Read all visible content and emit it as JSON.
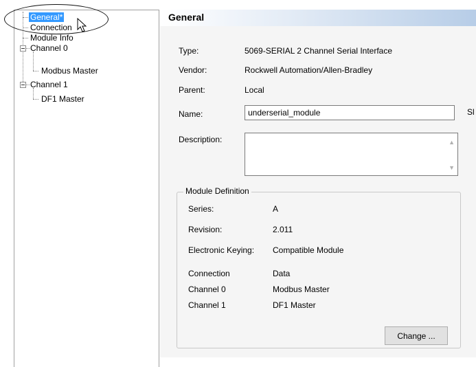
{
  "tree": {
    "items": [
      {
        "label": "General*",
        "selected": true
      },
      {
        "label": "Connection"
      },
      {
        "label": "Module Info"
      },
      {
        "label": "Channel 0"
      },
      {
        "label": "Modbus Master"
      },
      {
        "label": "Channel 1"
      },
      {
        "label": "DF1 Master"
      }
    ]
  },
  "header": {
    "title": "General"
  },
  "general": {
    "type_label": "Type:",
    "type_value": "5069-SERIAL 2 Channel Serial Interface",
    "vendor_label": "Vendor:",
    "vendor_value": "Rockwell Automation/Allen-Bradley",
    "parent_label": "Parent:",
    "parent_value": "Local",
    "name_label": "Name:",
    "name_value": "underserial_module",
    "slot_label": "Sl",
    "description_label": "Description:",
    "description_value": ""
  },
  "module_definition": {
    "legend": "Module Definition",
    "series_label": "Series:",
    "series_value": "A",
    "revision_label": "Revision:",
    "revision_value": "2.011",
    "keying_label": "Electronic Keying:",
    "keying_value": "Compatible Module",
    "rows": [
      {
        "label": "Connection",
        "value": "Data"
      },
      {
        "label": "Channel 0",
        "value": "Modbus Master"
      },
      {
        "label": "Channel 1",
        "value": "DF1 Master"
      }
    ],
    "change_button": "Change ..."
  }
}
